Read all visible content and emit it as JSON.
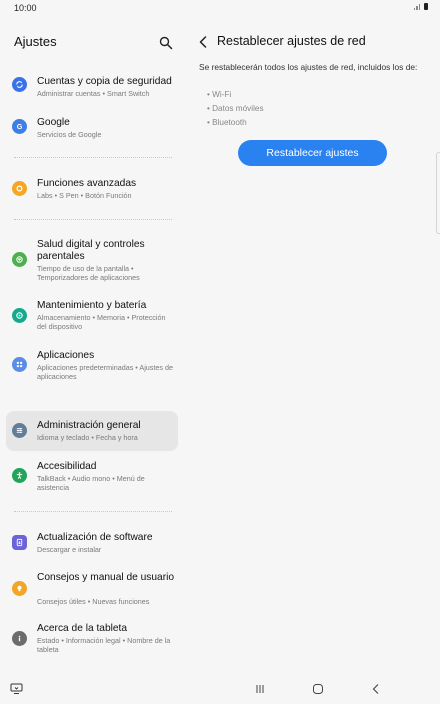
{
  "status_bar": {
    "time": "10:00"
  },
  "left_pane": {
    "title": "Ajustes",
    "items": [
      {
        "title": "Cuentas y copia de seguridad",
        "subtitle": "Administrar cuentas  •  Smart Switch",
        "icon": "sync-icon",
        "color": "#3a73e8"
      },
      {
        "title": "Google",
        "subtitle": "Servicios de Google",
        "icon": "google-icon",
        "color": "#3d7ee8"
      },
      {
        "title": "Funciones avanzadas",
        "subtitle": "Labs  •  S Pen  •  Botón Función",
        "icon": "gear-plus-icon",
        "color": "#f5a623"
      },
      {
        "title": "Salud digital y controles parentales",
        "subtitle": "Tiempo de uso de la pantalla  •  Temporizadores de aplicaciones",
        "icon": "heart-icon",
        "color": "#4cb050"
      },
      {
        "title": "Mantenimiento y batería",
        "subtitle": "Almacenamiento  •  Memoria  •  Protección del dispositivo",
        "icon": "maintenance-icon",
        "color": "#17a98c"
      },
      {
        "title": "Aplicaciones",
        "subtitle": "Aplicaciones predeterminadas  •  Ajustes de aplicaciones",
        "icon": "apps-grid-icon",
        "color": "#5b8de8"
      },
      {
        "title": "Administración general",
        "subtitle": "Idioma y teclado  •  Fecha y hora",
        "icon": "sliders-icon",
        "color": "#617d9a"
      },
      {
        "title": "Accesibilidad",
        "subtitle": "TalkBack  •  Audio mono  •  Menú de asistencia",
        "icon": "accessibility-icon",
        "color": "#24a35a"
      },
      {
        "title": "Actualización de software",
        "subtitle": "Descargar e instalar",
        "icon": "software-update-icon",
        "color": "#6c63d8"
      },
      {
        "title": "Consejos y manual de usuario",
        "subtitle": "Consejos útiles  •  Nuevas funciones",
        "icon": "lightbulb-icon",
        "color": "#f3a525"
      },
      {
        "title": "Acerca de la tableta",
        "subtitle": "Estado  •  Información legal  •  Nombre de la tableta",
        "icon": "info-icon",
        "color": "#6c6c6c"
      }
    ]
  },
  "right_pane": {
    "title": "Restablecer ajustes de red",
    "description": "Se restablecerán todos los ajustes de red, incluidos los de:",
    "bullets": [
      "• Wi-Fi",
      "• Datos móviles",
      "• Bluetooth"
    ],
    "reset_button_label": "Restablecer ajustes",
    "accent_color": "#2a81f0"
  }
}
